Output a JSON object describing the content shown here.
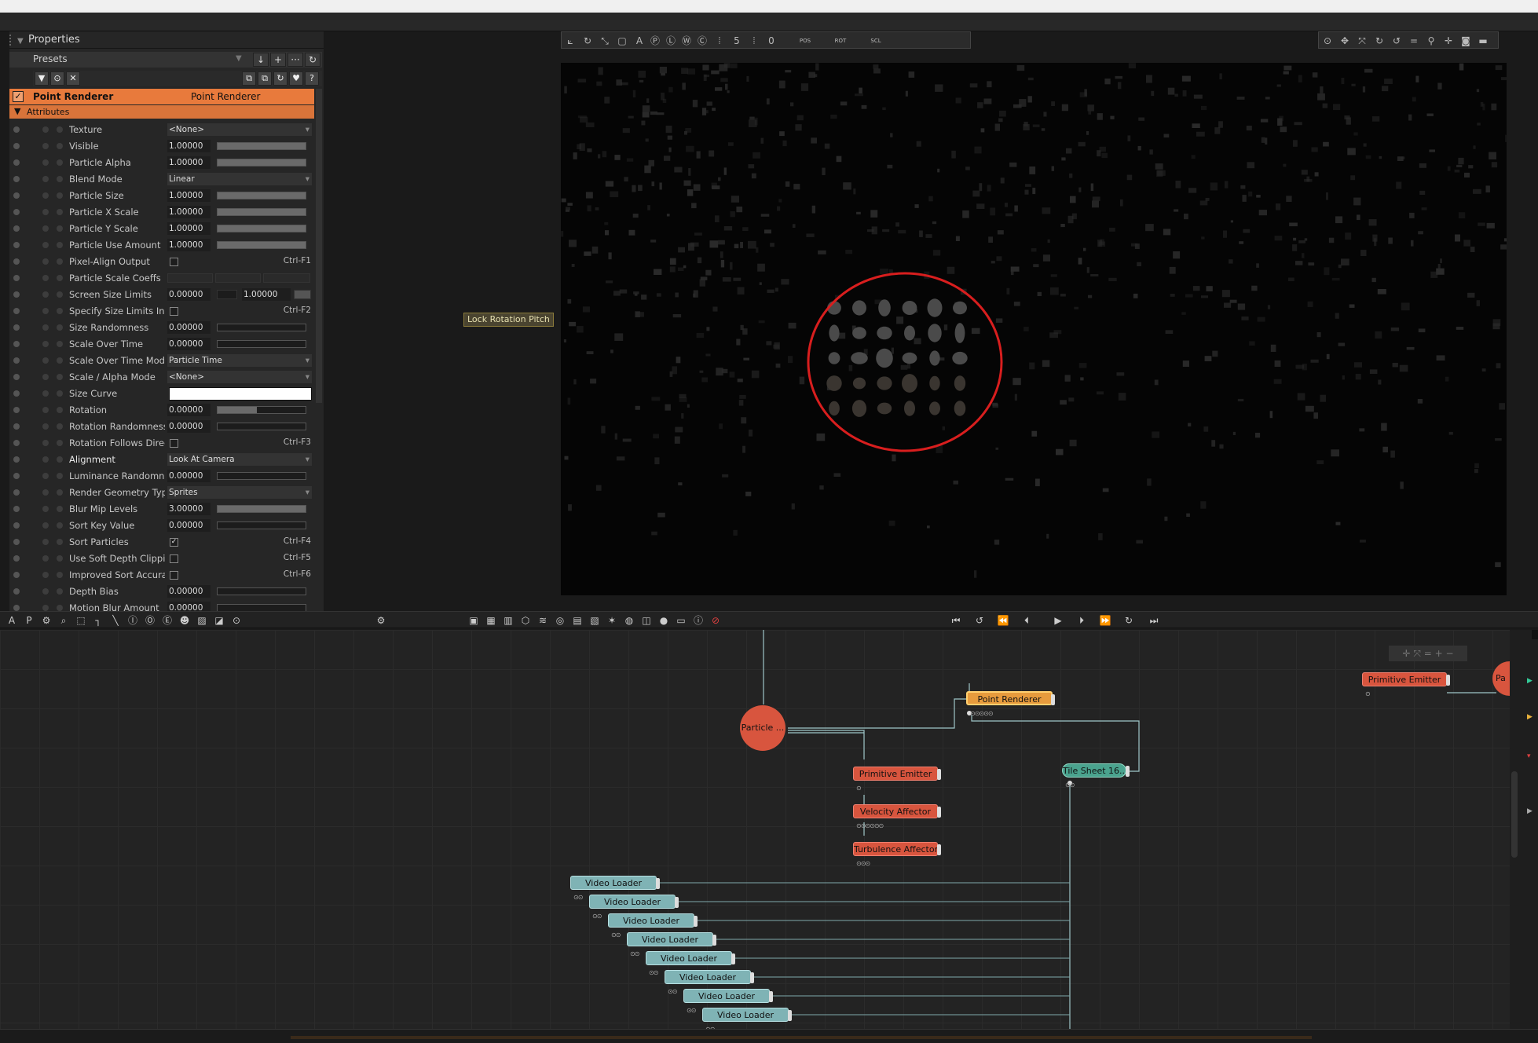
{
  "properties": {
    "title": "Properties",
    "presets_label": "Presets",
    "preset_buttons": [
      "↓",
      "+",
      "···",
      "↻"
    ],
    "filter_buttons": [
      "▼",
      "⊙",
      "✕"
    ],
    "filter_right_buttons": [
      "⧉",
      "⧉",
      "↻",
      "♥",
      "?"
    ],
    "node_checked": "✓",
    "node_title": "Point Renderer",
    "node_type": "Point Renderer",
    "attributes_label": "Attributes",
    "rows": [
      {
        "name": "Texture",
        "kind": "dropdown",
        "value": "<None>"
      },
      {
        "name": "Visible",
        "kind": "slider",
        "value": "1.00000",
        "fill": 1
      },
      {
        "name": "Particle Alpha",
        "kind": "slider",
        "value": "1.00000",
        "fill": 1
      },
      {
        "name": "Blend Mode",
        "kind": "dropdown",
        "value": "Linear"
      },
      {
        "name": "Particle Size",
        "kind": "slider",
        "value": "1.00000",
        "fill": 1
      },
      {
        "name": "Particle X Scale",
        "kind": "slider",
        "value": "1.00000",
        "fill": 1
      },
      {
        "name": "Particle Y Scale",
        "kind": "slider",
        "value": "1.00000",
        "fill": 1
      },
      {
        "name": "Particle Use Amount",
        "kind": "slider",
        "value": "1.00000",
        "fill": 1
      },
      {
        "name": "Pixel-Align Output",
        "kind": "check",
        "checked": false,
        "shortcut": "Ctrl-F1"
      },
      {
        "name": "Particle Scale Coeffs",
        "kind": "coeffs"
      },
      {
        "name": "Screen Size Limits",
        "kind": "range",
        "value": "0.00000",
        "value2": "1.00000"
      },
      {
        "name": "Specify Size Limits In Pi",
        "kind": "check",
        "checked": false,
        "shortcut": "Ctrl-F2"
      },
      {
        "name": "Size Randomness",
        "kind": "slider",
        "value": "0.00000",
        "fill": 0
      },
      {
        "name": "Scale Over Time",
        "kind": "slider",
        "value": "0.00000",
        "fill": 0
      },
      {
        "name": "Scale Over Time Mode",
        "kind": "dropdown",
        "value": "Particle Time"
      },
      {
        "name": "Scale / Alpha Mode",
        "kind": "dropdown",
        "value": "<None>"
      },
      {
        "name": "Size Curve",
        "kind": "curve"
      },
      {
        "name": "Rotation",
        "kind": "slider",
        "value": "0.00000",
        "fill": 0.45
      },
      {
        "name": "Rotation Randomness",
        "kind": "slider",
        "value": "0.00000",
        "fill": 0
      },
      {
        "name": "Rotation Follows Direct",
        "kind": "check",
        "checked": false,
        "shortcut": "Ctrl-F3"
      },
      {
        "name": "Alignment",
        "kind": "dropdown",
        "value": "Look At Camera",
        "bold": true
      },
      {
        "name": "Luminance Randomnes",
        "kind": "slider",
        "value": "0.00000",
        "fill": 0
      },
      {
        "name": "Render Geometry Type",
        "kind": "dropdown",
        "value": "Sprites"
      },
      {
        "name": "Blur Mip Levels",
        "kind": "slider",
        "value": "3.00000",
        "fill": 1
      },
      {
        "name": "Sort Key Value",
        "kind": "slider",
        "value": "0.00000",
        "fill": 0
      },
      {
        "name": "Sort Particles",
        "kind": "check",
        "checked": true,
        "shortcut": "Ctrl-F4"
      },
      {
        "name": "Use Soft Depth Clipping",
        "kind": "check",
        "checked": false,
        "shortcut": "Ctrl-F5"
      },
      {
        "name": "Improved Sort Accurac",
        "kind": "check",
        "checked": false,
        "shortcut": "Ctrl-F6"
      },
      {
        "name": "Depth Bias",
        "kind": "slider",
        "value": "0.00000",
        "fill": 0
      },
      {
        "name": "Motion Blur Amount",
        "kind": "slider",
        "value": "0.00000",
        "fill": 0
      }
    ]
  },
  "tooltip": "Lock Rotation Pitch",
  "viewport_toolbar": {
    "frame_a": "5",
    "frame_b": "0",
    "lock_labels": [
      "POS",
      "ROT",
      "SCL"
    ]
  },
  "panel_bar_left": [
    "A",
    "P"
  ],
  "graph": {
    "particle_node": "Particle ...",
    "point_renderer": "Point Renderer",
    "primitive_emitter": "Primitive Emitter",
    "velocity_affector": "Velocity Affector",
    "turbulence_affector": "Turbulence Affector",
    "tile_sheet": "Tile Sheet 16...",
    "primitive_emitter_2": "Primitive Emitter",
    "video_loader": "Video Loader",
    "offscreen_node": "Pa"
  },
  "colors": {
    "accent": "#e87a3c",
    "selection_ring": "#d81e1e",
    "node_red": "#d8553e",
    "node_teal": "#7fb3b5"
  }
}
